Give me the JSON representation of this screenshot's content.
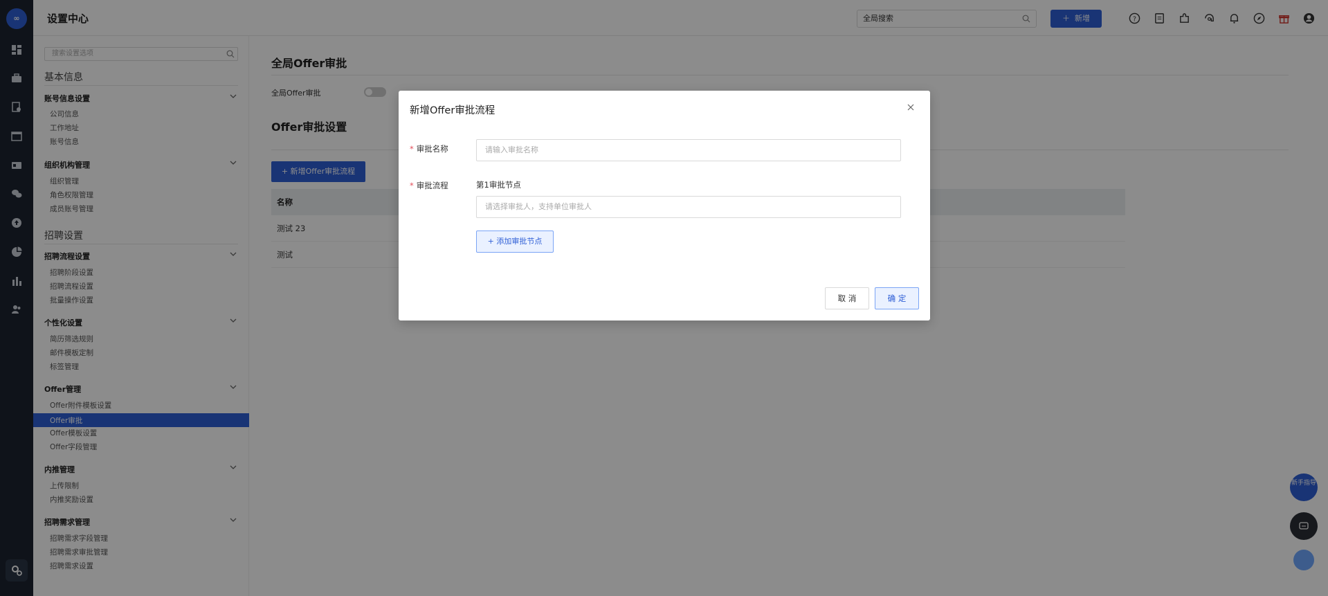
{
  "header": {
    "title": "设置中心",
    "search_placeholder": "全局搜索",
    "new_label": "新增"
  },
  "sidebar": {
    "search_placeholder": "搜索设置选项",
    "section1": "基本信息",
    "section2": "招聘设置",
    "groups": {
      "account": "账号信息设置",
      "org": "组织机构管理",
      "flow": "招聘流程设置",
      "personal": "个性化设置",
      "offer": "Offer管理",
      "referral": "内推管理",
      "demand": "招聘需求管理"
    },
    "items": {
      "company": "公司信息",
      "address": "工作地址",
      "account_info": "账号信息",
      "org_manage": "组织管理",
      "role_perm": "角色权限管理",
      "member_account": "成员账号管理",
      "stage": "招聘阶段设置",
      "process": "招聘流程设置",
      "batch": "批量操作设置",
      "resume_filter": "简历筛选规则",
      "mail_template": "邮件模板定制",
      "tag_manage": "标签管理",
      "offer_attach": "Offer附件模板设置",
      "offer_approval": "Offer审批",
      "offer_template": "Offer模板设置",
      "offer_field": "Offer字段管理",
      "upload_limit": "上传限制",
      "referral_reward": "内推奖励设置",
      "demand_field": "招聘需求字段管理",
      "demand_approval": "招聘需求审批管理",
      "demand_setting": "招聘需求设置"
    }
  },
  "main": {
    "title": "全局Offer审批",
    "toggle_label": "全局Offer审批",
    "section_title": "Offer审批设置",
    "add_button": "+ 新增Offer审批流程",
    "table": {
      "header": "名称",
      "rows": [
        "测试 23",
        "测试"
      ]
    }
  },
  "float": {
    "guide": "新手指导"
  },
  "modal": {
    "title": "新增Offer审批流程",
    "required_mark": "*",
    "name_label": "审批名称",
    "name_placeholder": "请输入审批名称",
    "flow_label": "审批流程",
    "node_label": "第1审批节点",
    "approver_placeholder": "请选择审批人，支持单位审批人",
    "add_node": "+ 添加审批节点",
    "cancel": "取 消",
    "ok": "确 定"
  }
}
